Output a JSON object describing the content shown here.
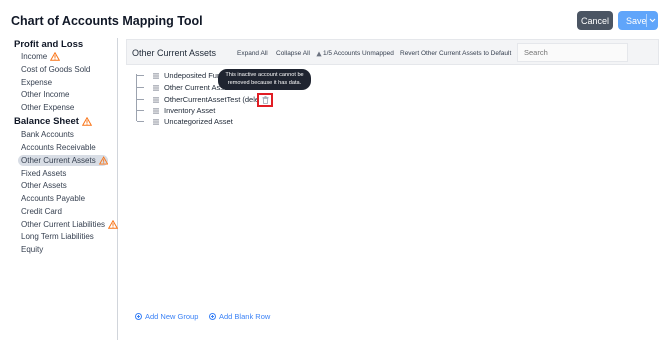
{
  "header": {
    "title": "Chart of Accounts Mapping Tool",
    "cancel_label": "Cancel",
    "save_label": "Save"
  },
  "sidebar": {
    "sections": [
      {
        "title": "Profit and Loss",
        "warning": false,
        "items": [
          {
            "label": "Income",
            "warning": true
          },
          {
            "label": "Cost of Goods Sold",
            "warning": false
          },
          {
            "label": "Expense",
            "warning": false
          },
          {
            "label": "Other Income",
            "warning": false
          },
          {
            "label": "Other Expense",
            "warning": false
          }
        ]
      },
      {
        "title": "Balance Sheet",
        "warning": true,
        "items": [
          {
            "label": "Bank Accounts",
            "warning": false
          },
          {
            "label": "Accounts Receivable",
            "warning": false
          },
          {
            "label": "Other Current Assets",
            "warning": true,
            "active": true
          },
          {
            "label": "Fixed Assets",
            "warning": false
          },
          {
            "label": "Other Assets",
            "warning": false
          },
          {
            "label": "Accounts Payable",
            "warning": false
          },
          {
            "label": "Credit Card",
            "warning": false
          },
          {
            "label": "Other Current Liabilities",
            "warning": true
          },
          {
            "label": "Long Term Liabilities",
            "warning": false
          },
          {
            "label": "Equity",
            "warning": false
          }
        ]
      }
    ]
  },
  "toolbar": {
    "title": "Other Current Assets",
    "expand_all": "Expand All",
    "collapse_all": "Collapse All",
    "unmapped": "1/5 Accounts Unmapped",
    "revert": "Revert Other Current Assets to Default",
    "search_placeholder": "Search"
  },
  "tree": {
    "items": [
      "Undeposited Fund",
      "Other Current Asse",
      "OtherCurrentAssetTest (delete",
      "Inventory Asset",
      "Uncategorized Asset"
    ]
  },
  "tooltip": {
    "line1": "This inactive account cannot be",
    "line2": "removed because it has data."
  },
  "footer": {
    "add_group": "Add New Group",
    "add_row": "Add Blank Row"
  },
  "colors": {
    "warning": "#f97316",
    "accent": "#3b82f6",
    "highlight": "#e11d24"
  }
}
